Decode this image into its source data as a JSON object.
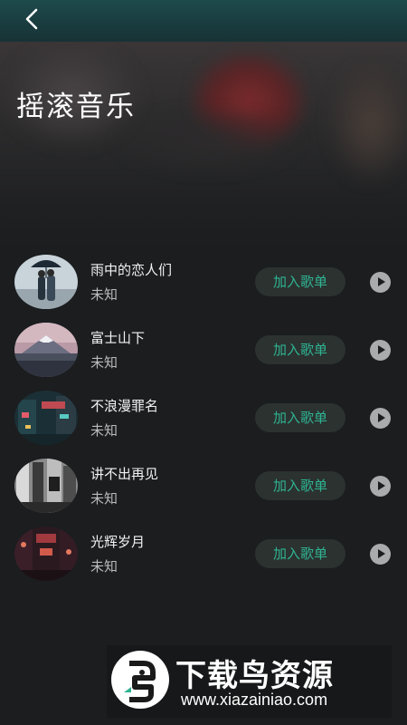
{
  "header": {
    "back_icon": "chevron-left-icon",
    "background_color": "#1d4a4c"
  },
  "page": {
    "title": "摇滚音乐"
  },
  "songs": [
    {
      "title": "雨中的恋人们",
      "artist": "未知",
      "add_label": "加入歌单",
      "cover": "couple-umbrella-cover"
    },
    {
      "title": "富士山下",
      "artist": "未知",
      "add_label": "加入歌单",
      "cover": "mount-fuji-cover"
    },
    {
      "title": "不浪漫罪名",
      "artist": "未知",
      "add_label": "加入歌单",
      "cover": "night-street-cover"
    },
    {
      "title": "讲不出再见",
      "artist": "未知",
      "add_label": "加入歌单",
      "cover": "bw-city-cover"
    },
    {
      "title": "光辉岁月",
      "artist": "未知",
      "add_label": "加入歌单",
      "cover": "red-alley-cover"
    }
  ],
  "colors": {
    "accent": "#2fb391",
    "background": "#1b1d1f",
    "button_bg": "#2b3230"
  },
  "watermark": {
    "title": "下载鸟资源",
    "url": "www.xiazainiao.com"
  }
}
